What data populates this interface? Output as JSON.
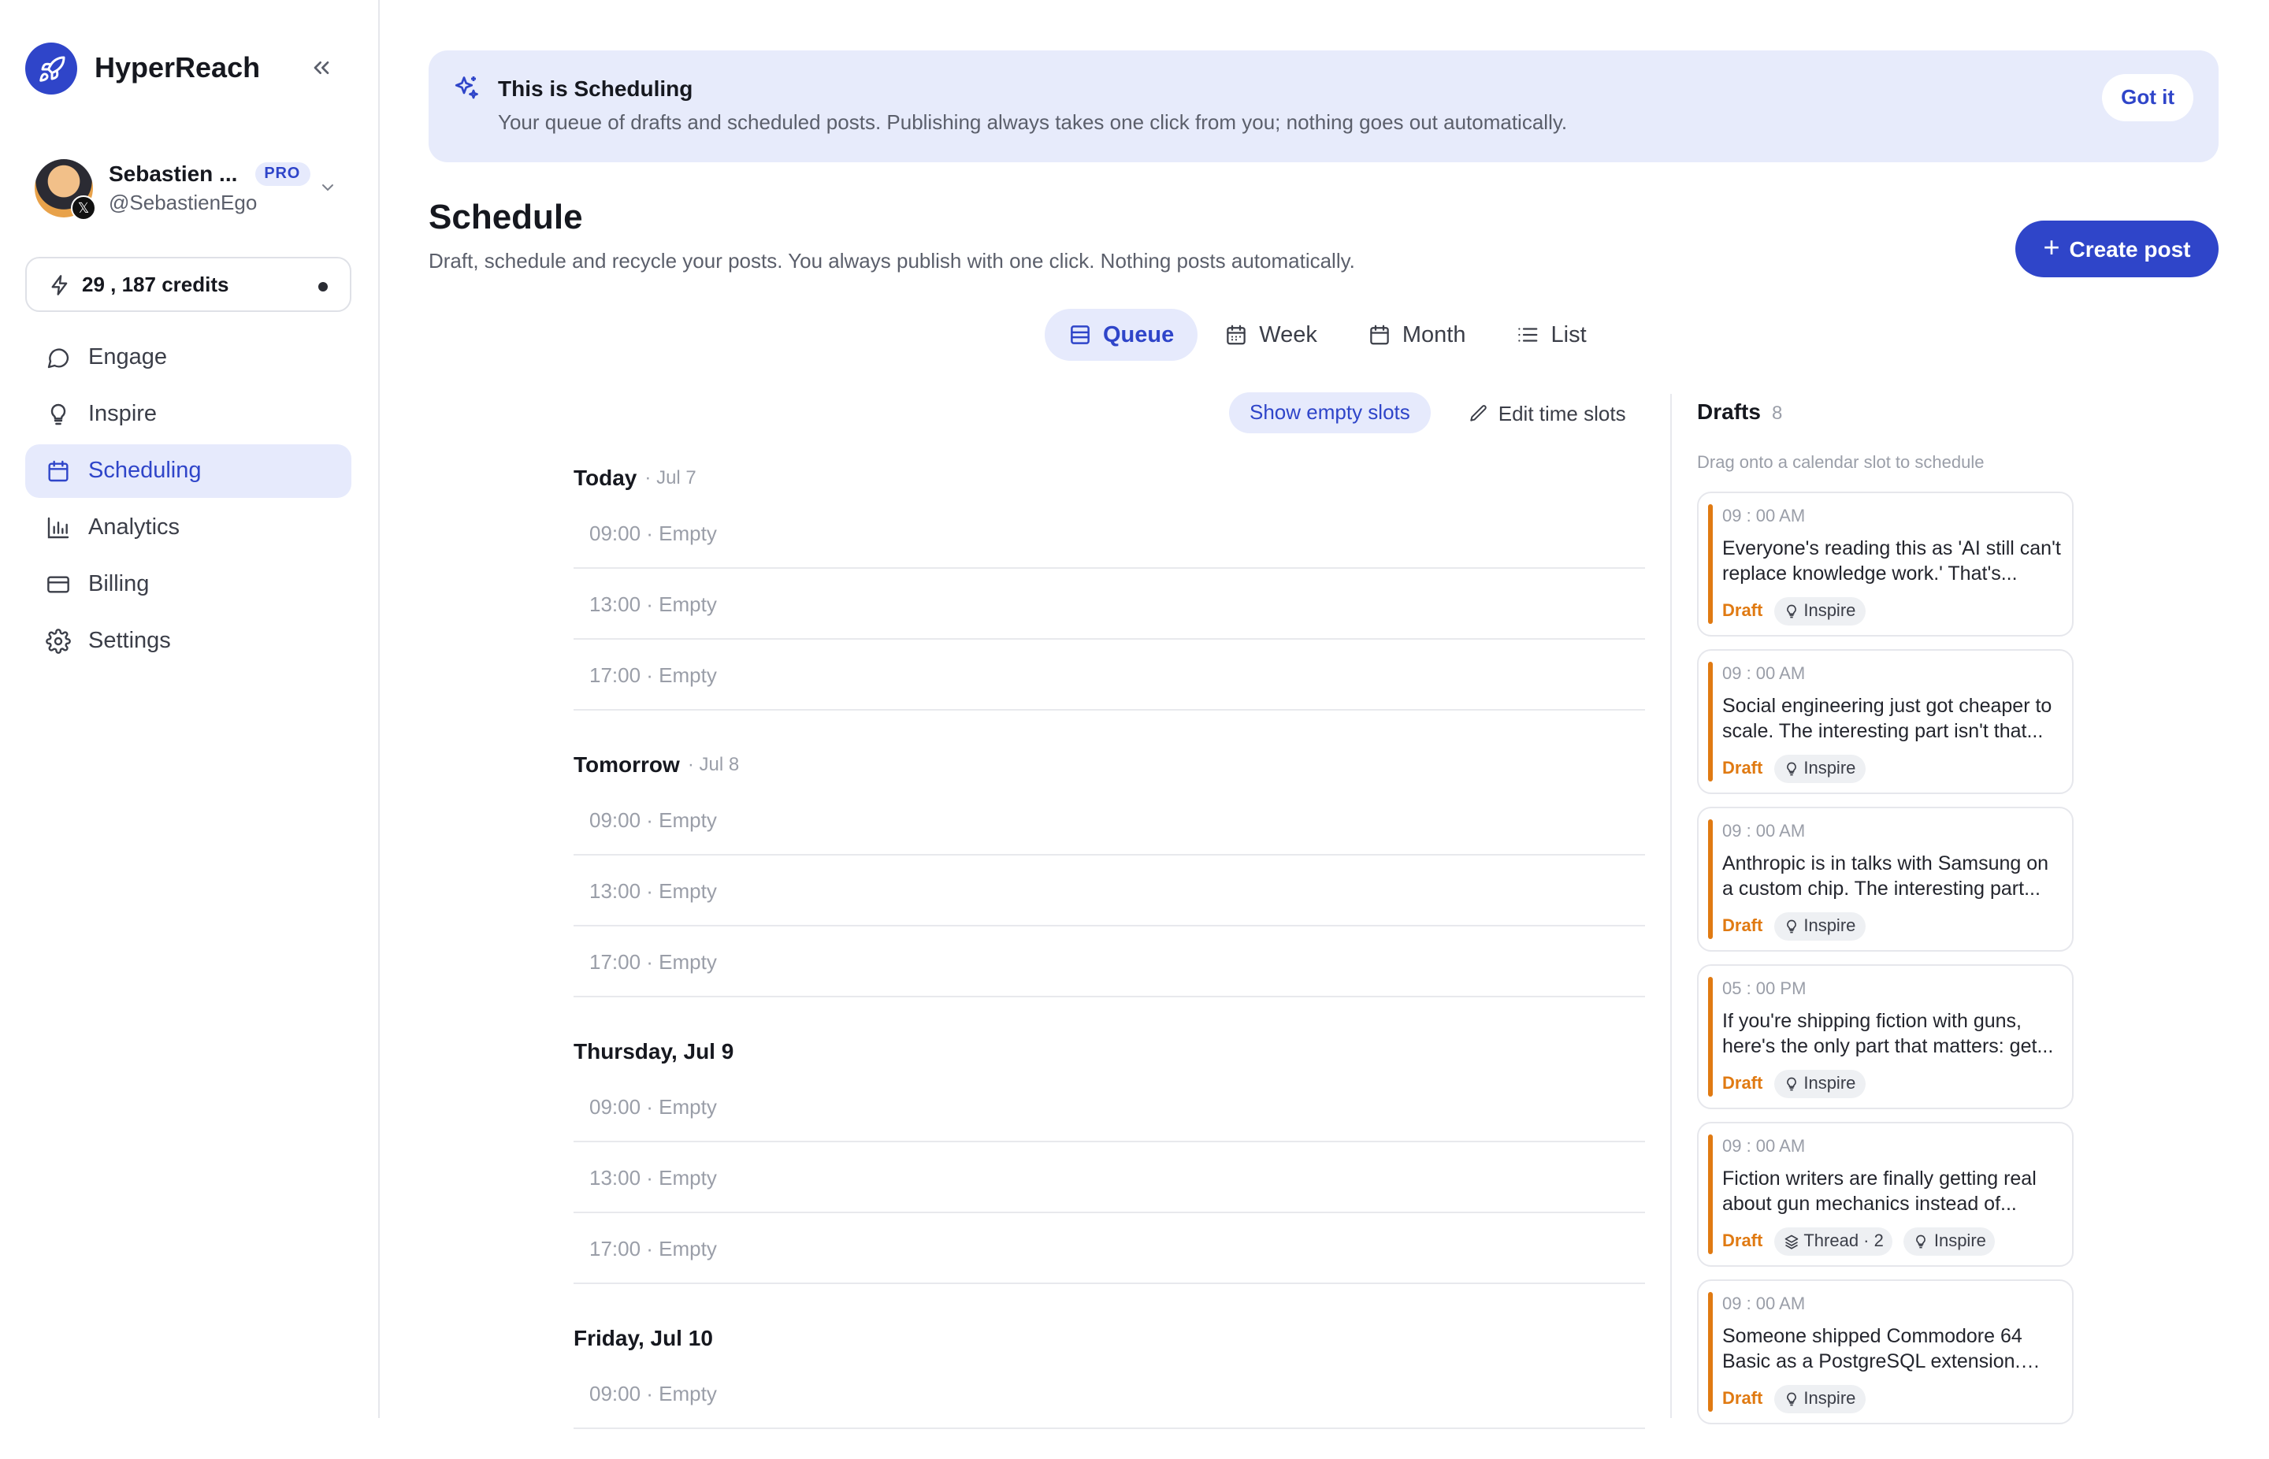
{
  "brand": {
    "name": "HyperReach",
    "accent": "#2f45c9"
  },
  "profile": {
    "name": "Sebastien ...",
    "badge": "PRO",
    "handle": "@SebastienEgo"
  },
  "credits": {
    "label": "29 , 187 credits"
  },
  "nav": [
    {
      "label": "Engage",
      "icon": "chat-bubble-icon",
      "active": false
    },
    {
      "label": "Inspire",
      "icon": "lightbulb-icon",
      "active": false
    },
    {
      "label": "Scheduling",
      "icon": "calendar-icon",
      "active": true
    },
    {
      "label": "Analytics",
      "icon": "bar-chart-icon",
      "active": false
    },
    {
      "label": "Billing",
      "icon": "credit-card-icon",
      "active": false
    },
    {
      "label": "Settings",
      "icon": "gear-icon",
      "active": false
    }
  ],
  "banner": {
    "title": "This is Scheduling",
    "text": "Your queue of drafts and scheduled posts. Publishing always takes one click from you; nothing goes out automatically.",
    "dismiss_label": "Got it"
  },
  "page": {
    "title": "Schedule",
    "subtitle": "Draft, schedule and recycle your posts. You always publish with one click. Nothing posts automatically.",
    "create_label": "Create post"
  },
  "view_tabs": [
    {
      "label": "Queue",
      "active": true
    },
    {
      "label": "Week",
      "active": false
    },
    {
      "label": "Month",
      "active": false
    },
    {
      "label": "List",
      "active": false
    }
  ],
  "controls": {
    "show_empty_label": "Show empty slots",
    "edit_slots_label": "Edit time slots"
  },
  "queue": [
    {
      "day": "Today",
      "date": "· Jul 7",
      "slots": [
        "09:00 · Empty",
        "13:00 · Empty",
        "17:00 · Empty"
      ]
    },
    {
      "day": "Tomorrow",
      "date": "· Jul 8",
      "slots": [
        "09:00 · Empty",
        "13:00 · Empty",
        "17:00 · Empty"
      ]
    },
    {
      "day": "Thursday, Jul 9",
      "date": "",
      "slots": [
        "09:00 · Empty",
        "13:00 · Empty",
        "17:00 · Empty"
      ]
    },
    {
      "day": "Friday, Jul 10",
      "date": "",
      "slots": [
        "09:00 · Empty"
      ]
    }
  ],
  "drafts": {
    "title": "Drafts",
    "count": "8",
    "hint": "Drag onto a calendar slot to schedule",
    "status_color": "#e07a12",
    "items": [
      {
        "time": "09 : 00 AM",
        "text": "Everyone's reading this as 'AI still can't replace knowledge work.' That's...",
        "status": "Draft",
        "chips": [
          "Inspire"
        ]
      },
      {
        "time": "09 : 00 AM",
        "text": "Social engineering just got cheaper to scale. The interesting part isn't that...",
        "status": "Draft",
        "chips": [
          "Inspire"
        ]
      },
      {
        "time": "09 : 00 AM",
        "text": "Anthropic is in talks with Samsung on a custom chip. The interesting part...",
        "status": "Draft",
        "chips": [
          "Inspire"
        ]
      },
      {
        "time": "05 : 00 PM",
        "text": "If you're shipping fiction with guns, here's the only part that matters: get...",
        "status": "Draft",
        "chips": [
          "Inspire"
        ]
      },
      {
        "time": "09 : 00 AM",
        "text": "Fiction writers are finally getting real about gun mechanics instead of...",
        "status": "Draft",
        "chips": [
          "Thread · 2",
          "Inspire"
        ]
      },
      {
        "time": "09 : 00 AM",
        "text": "Someone shipped Commodore 64 Basic as a PostgreSQL extension. Th...",
        "status": "Draft",
        "chips": [
          "Inspire"
        ]
      }
    ]
  }
}
